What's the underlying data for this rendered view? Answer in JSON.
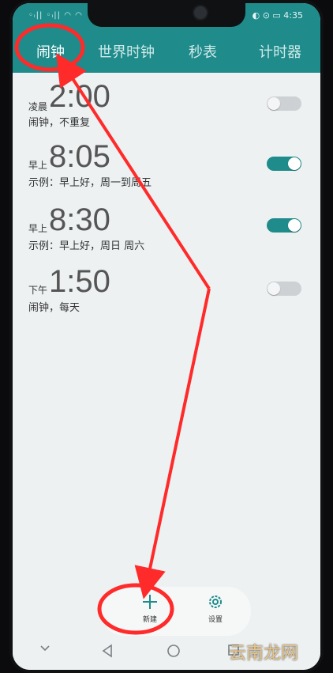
{
  "status_bar": {
    "left": "◦ᵢ|| ◦ᵢ|| ◠ ◠",
    "right": "◐ ⊙ ▭ 4:35"
  },
  "tabs": [
    {
      "label": "闹钟",
      "active": true
    },
    {
      "label": "世界时钟",
      "active": false
    },
    {
      "label": "秒表",
      "active": false
    },
    {
      "label": "计时器",
      "active": false
    }
  ],
  "alarms": [
    {
      "period": "凌晨",
      "time": "2:00",
      "desc": "闹钟，不重复",
      "enabled": false
    },
    {
      "period": "早上",
      "time": "8:05",
      "desc": "示例：早上好，周一到周五",
      "enabled": true
    },
    {
      "period": "早上",
      "time": "8:30",
      "desc": "示例：早上好，周日 周六",
      "enabled": true
    },
    {
      "period": "下午",
      "time": "1:50",
      "desc": "闹钟，每天",
      "enabled": false
    }
  ],
  "bottom_bar": {
    "new_label": "新建",
    "settings_label": "设置"
  },
  "watermark": "云南龙网",
  "colors": {
    "accent": "#1f8b8b",
    "annotation_red": "#ff2a2a",
    "background": "#edf1f2"
  },
  "icons": {
    "new": "plus-icon",
    "settings": "gear-icon",
    "nav_down": "chevron-down-icon",
    "nav_back": "triangle-back-icon",
    "nav_home": "circle-home-icon",
    "nav_recent": "square-recent-icon"
  }
}
